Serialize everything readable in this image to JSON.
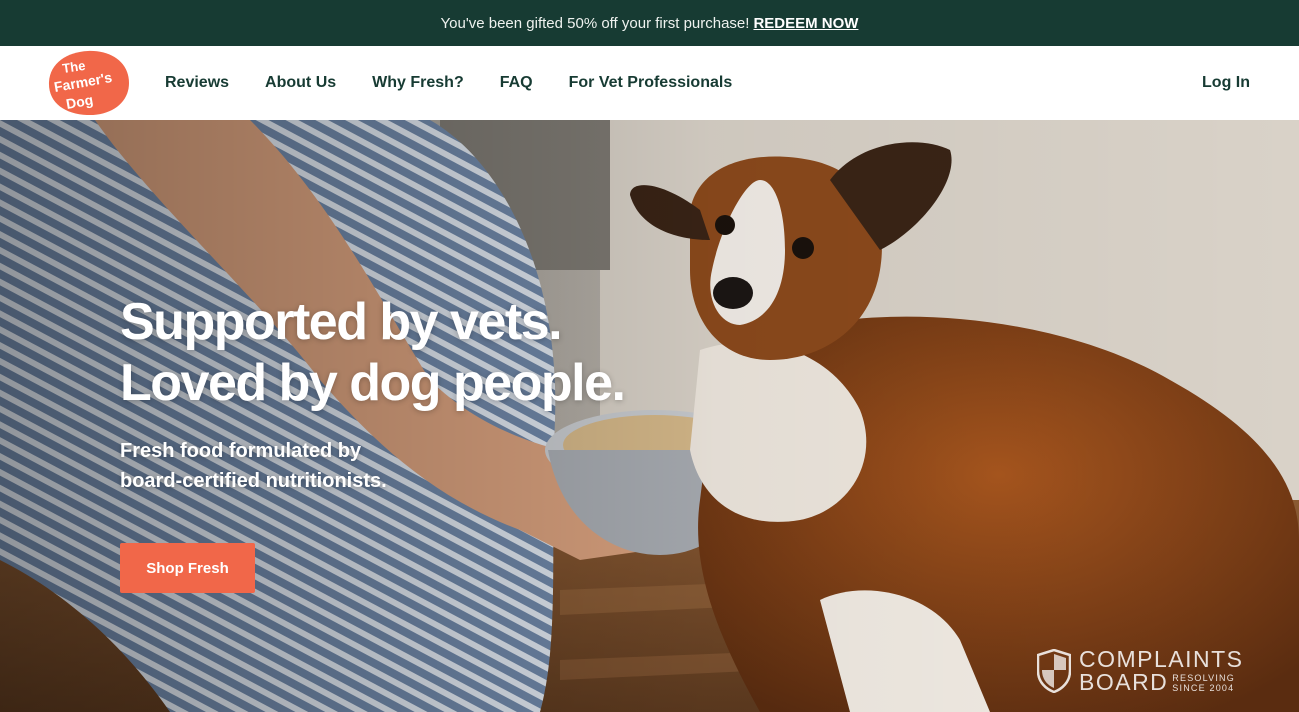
{
  "promo": {
    "message": "You've been gifted 50% off your first purchase!",
    "link_label": "REDEEM NOW"
  },
  "header": {
    "logo": {
      "line1": "The",
      "line2": "Farmer's",
      "line3": "Dog",
      "color": "#f16749"
    },
    "nav": [
      {
        "label": "Reviews"
      },
      {
        "label": "About Us"
      },
      {
        "label": "Why Fresh?"
      },
      {
        "label": "FAQ"
      },
      {
        "label": "For Vet Professionals"
      }
    ],
    "login_label": "Log In"
  },
  "hero": {
    "headline_line1": "Supported by vets.",
    "headline_line2": "Loved by dog people.",
    "subhead_line1": "Fresh food formulated by",
    "subhead_line2": "board-certified nutritionists.",
    "cta_label": "Shop Fresh",
    "cta_color": "#f16749"
  },
  "watermark": {
    "line1": "COMPLAINTS",
    "line2": "BOARD",
    "tag1": "RESOLVING",
    "tag2": "SINCE 2004"
  },
  "colors": {
    "brand_dark": "#173b33",
    "accent": "#f16749"
  }
}
